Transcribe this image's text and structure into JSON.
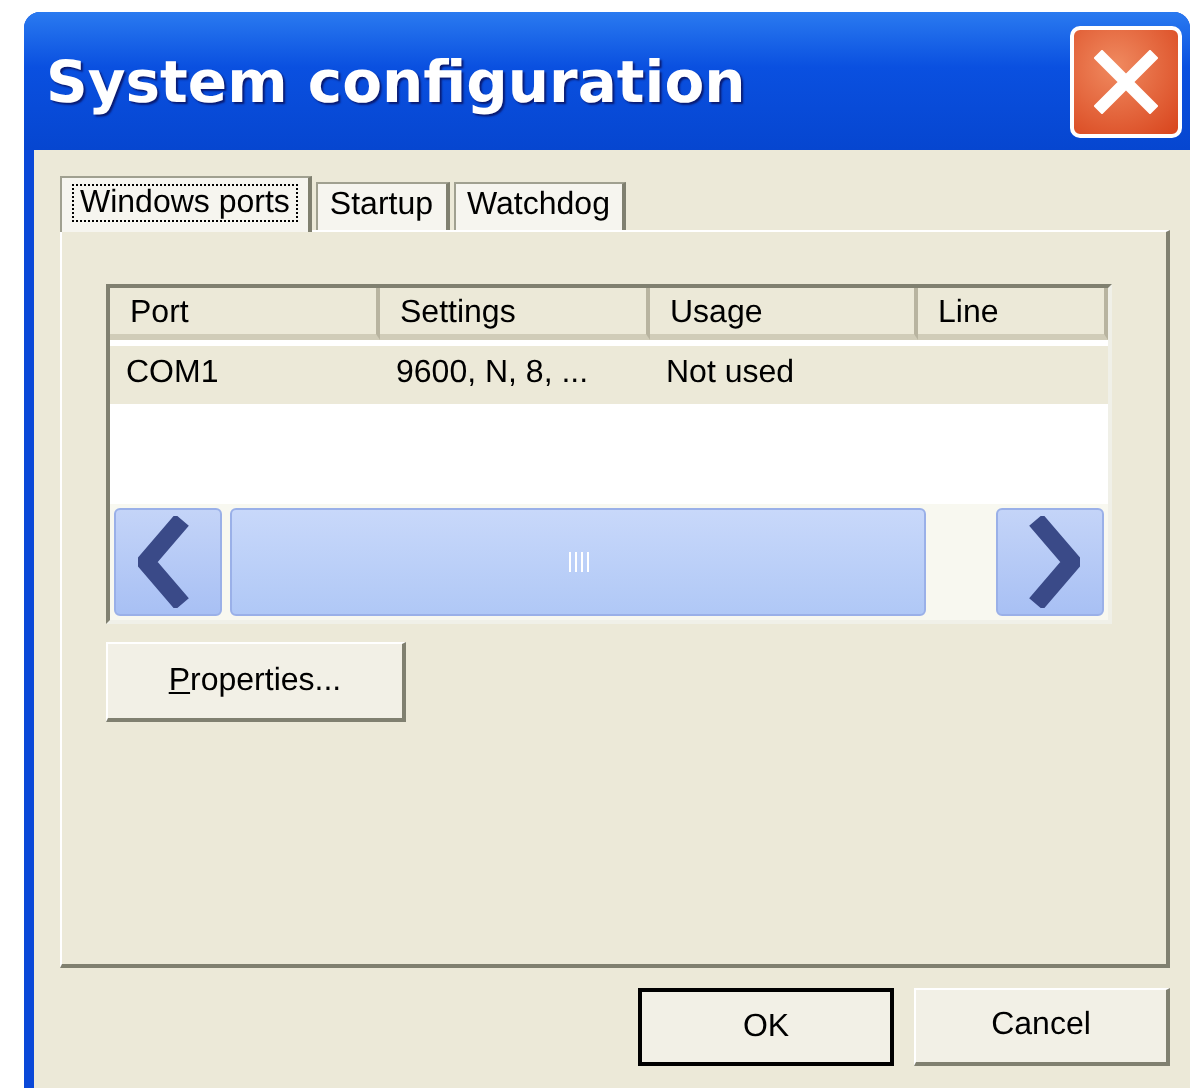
{
  "window": {
    "title": "System configuration"
  },
  "tabs": [
    {
      "label": "Windows ports",
      "selected": true
    },
    {
      "label": "Startup",
      "selected": false
    },
    {
      "label": "Watchdog",
      "selected": false
    }
  ],
  "ports_table": {
    "columns": [
      "Port",
      "Settings",
      "Usage",
      "Line"
    ],
    "rows": [
      {
        "cells": [
          "COM1",
          "9600, N, 8, ...",
          "Not used",
          ""
        ],
        "selected": true
      }
    ]
  },
  "properties_button": {
    "label": "Properties..."
  },
  "buttons": [
    {
      "label": "OK",
      "default": true
    },
    {
      "label": "Cancel",
      "default": false
    }
  ]
}
